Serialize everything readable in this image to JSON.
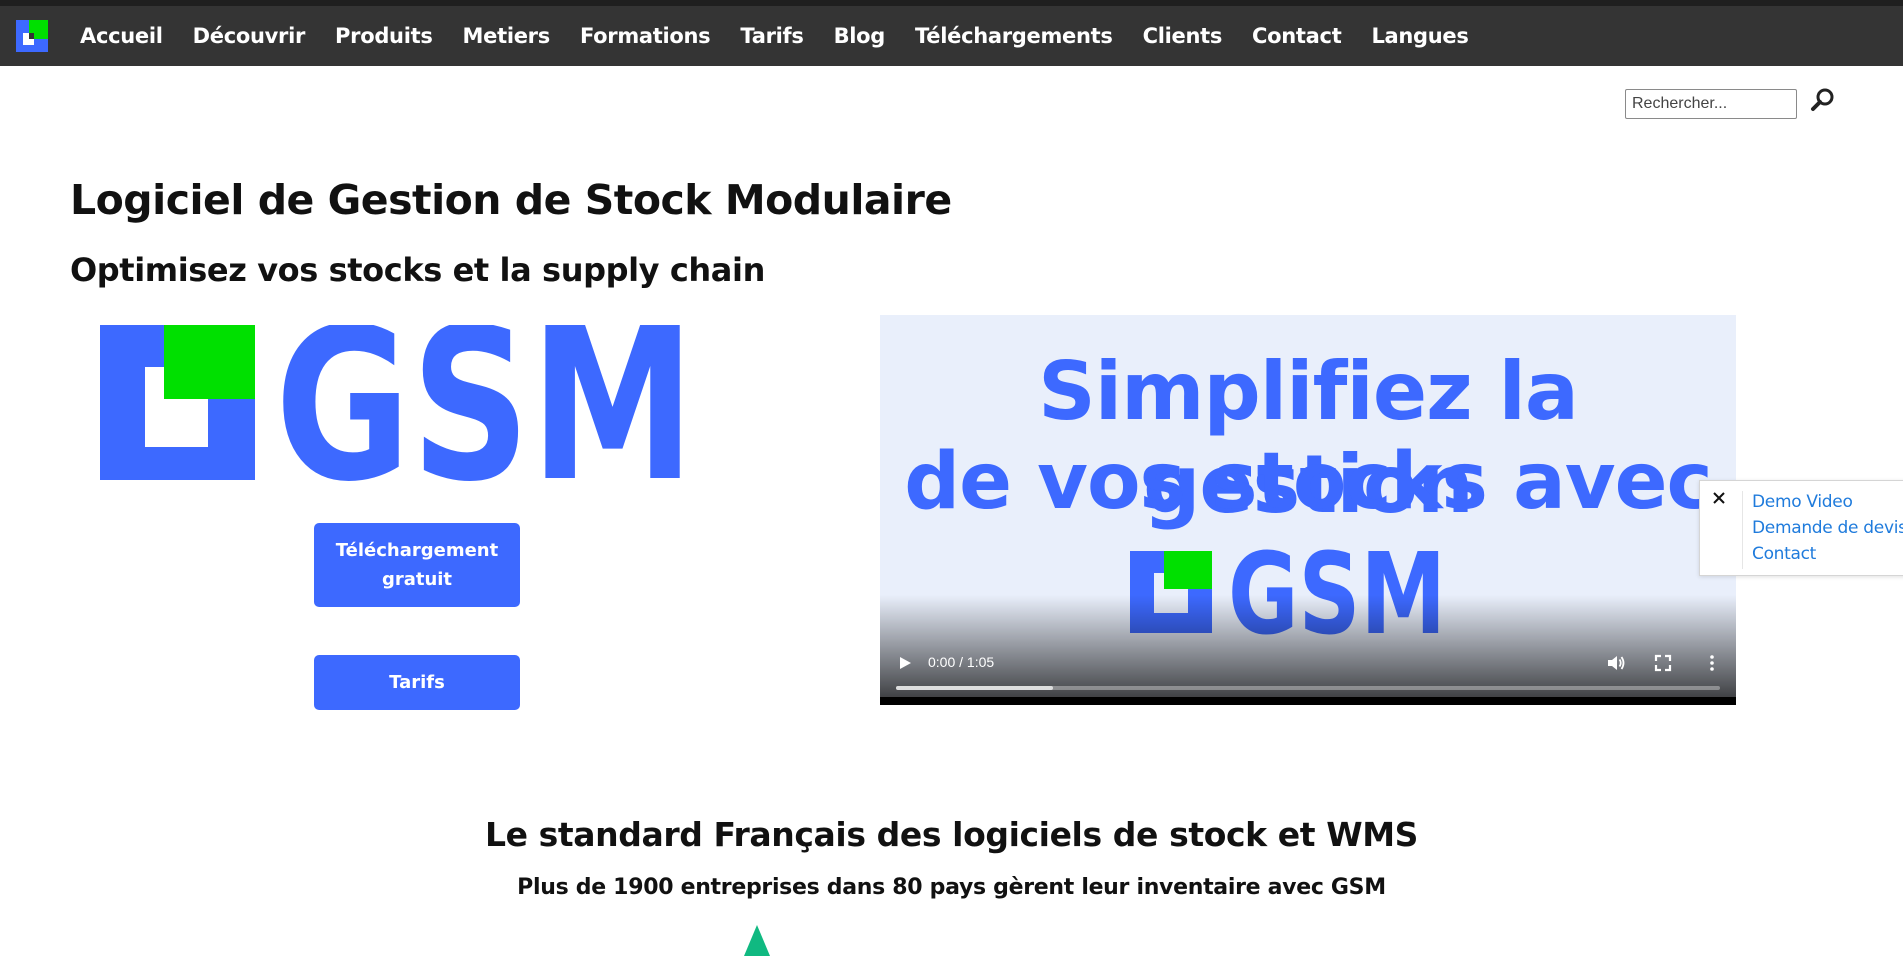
{
  "nav": {
    "items": [
      {
        "label": "Accueil"
      },
      {
        "label": "Découvrir"
      },
      {
        "label": "Produits"
      },
      {
        "label": "Metiers"
      },
      {
        "label": "Formations"
      },
      {
        "label": "Tarifs"
      },
      {
        "label": "Blog"
      },
      {
        "label": "Téléchargements"
      },
      {
        "label": "Clients"
      },
      {
        "label": "Contact"
      },
      {
        "label": "Langues"
      }
    ]
  },
  "search": {
    "placeholder": "Rechercher..."
  },
  "hero": {
    "title": "Logiciel de Gestion de Stock Modulaire",
    "subtitle": "Optimisez vos stocks et la supply chain",
    "logo_text": "GSM",
    "download_button": "Téléchargement gratuit",
    "pricing_button": "Tarifs"
  },
  "video": {
    "line1": "Simplifiez la gestion",
    "line2": "de vos stocks avec",
    "logo_text": "GSM",
    "time": "0:00 / 1:05",
    "buffered": 0.19
  },
  "side_panel": {
    "links": [
      {
        "label": "Demo Video"
      },
      {
        "label": "Demande de devis"
      },
      {
        "label": "Contact"
      }
    ]
  },
  "standard": {
    "heading": "Le standard Français des logiciels de stock et WMS",
    "subheading": "Plus de 1900 entreprises dans 80 pays gèrent leur inventaire avec GSM"
  },
  "colors": {
    "brand_blue": "#3d69ff",
    "brand_green": "#00e000",
    "nav_bg": "#343434",
    "link_blue": "#1f7bdc"
  },
  "icons": {
    "nav_logo": "gsm-logo-icon",
    "search": "search-icon",
    "play": "play-icon",
    "volume": "volume-icon",
    "fullscreen": "fullscreen-icon",
    "more": "more-vertical-icon",
    "close": "close-icon",
    "tree": "tree-icon"
  }
}
